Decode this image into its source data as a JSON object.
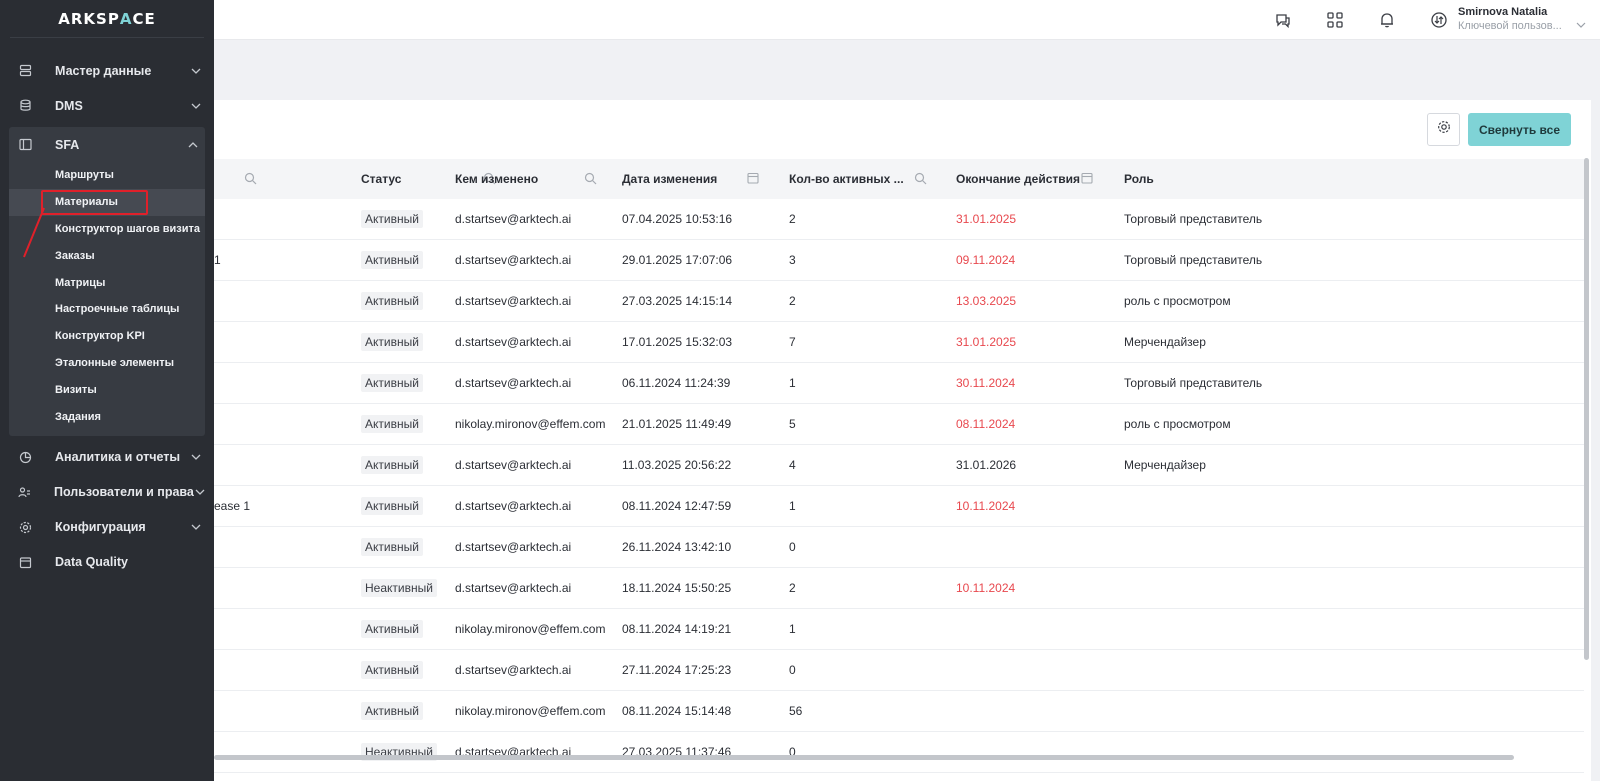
{
  "app": {
    "logo_a": "ARKSP",
    "logo_b": "A",
    "logo_c": "CE"
  },
  "sidebar": {
    "items_top": [
      {
        "label": "Мастер данные",
        "icon": "database-icon"
      },
      {
        "label": "DMS",
        "icon": "stack-icon"
      }
    ],
    "sfa": {
      "label": "SFA",
      "icon": "layout-icon",
      "sub": [
        "Маршруты",
        "Материалы",
        "Конструктор шагов визита",
        "Заказы",
        "Матрицы",
        "Настроечные таблицы",
        "Конструктор KPI",
        "Эталонные элементы",
        "Визиты",
        "Задания"
      ]
    },
    "items_bottom": [
      {
        "label": "Аналитика и отчеты",
        "icon": "chart-icon"
      },
      {
        "label": "Пользователи и права",
        "icon": "users-icon"
      },
      {
        "label": "Конфигурация",
        "icon": "gear-icon"
      },
      {
        "label": "Data Quality",
        "icon": "calendar-icon"
      }
    ]
  },
  "user": {
    "name": "Smirnova Natalia",
    "role": "Ключевой пользов..."
  },
  "toolbar": {
    "collapse_label": "Свернуть все"
  },
  "table": {
    "headers": [
      "Статус",
      "Кем изменено",
      "Дата изменения",
      "Кол-во активных ...",
      "Окончание действия",
      "Роль"
    ],
    "rows": [
      {
        "lead": "",
        "status": "Активный",
        "by": "d.startsev@arktech.ai",
        "date": "07.04.2025 10:53:16",
        "count": "2",
        "end": "31.01.2025",
        "end_expired": true,
        "role": "Торговый представитель"
      },
      {
        "lead": "1",
        "status": "Активный",
        "by": "d.startsev@arktech.ai",
        "date": "29.01.2025 17:07:06",
        "count": "3",
        "end": "09.11.2024",
        "end_expired": true,
        "role": "Торговый представитель"
      },
      {
        "lead": "",
        "status": "Активный",
        "by": "d.startsev@arktech.ai",
        "date": "27.03.2025 14:15:14",
        "count": "2",
        "end": "13.03.2025",
        "end_expired": true,
        "role": "роль с просмотром"
      },
      {
        "lead": "",
        "status": "Активный",
        "by": "d.startsev@arktech.ai",
        "date": "17.01.2025 15:32:03",
        "count": "7",
        "end": "31.01.2025",
        "end_expired": true,
        "role": "Мерчендайзер"
      },
      {
        "lead": "",
        "status": "Активный",
        "by": "d.startsev@arktech.ai",
        "date": "06.11.2024 11:24:39",
        "count": "1",
        "end": "30.11.2024",
        "end_expired": true,
        "role": "Торговый представитель"
      },
      {
        "lead": "",
        "status": "Активный",
        "by": "nikolay.mironov@effem.com",
        "date": "21.01.2025 11:49:49",
        "count": "5",
        "end": "08.11.2024",
        "end_expired": true,
        "role": "роль с просмотром"
      },
      {
        "lead": "",
        "status": "Активный",
        "by": "d.startsev@arktech.ai",
        "date": "11.03.2025 20:56:22",
        "count": "4",
        "end": "31.01.2026",
        "end_expired": false,
        "role": "Мерчендайзер"
      },
      {
        "lead": "ease 1",
        "status": "Активный",
        "by": "d.startsev@arktech.ai",
        "date": "08.11.2024 12:47:59",
        "count": "1",
        "end": "10.11.2024",
        "end_expired": true,
        "role": ""
      },
      {
        "lead": "",
        "status": "Активный",
        "by": "d.startsev@arktech.ai",
        "date": "26.11.2024 13:42:10",
        "count": "0",
        "end": "",
        "end_expired": false,
        "role": ""
      },
      {
        "lead": "",
        "status": "Неактивный",
        "by": "d.startsev@arktech.ai",
        "date": "18.11.2024 15:50:25",
        "count": "2",
        "end": "10.11.2024",
        "end_expired": true,
        "role": ""
      },
      {
        "lead": "",
        "status": "Активный",
        "by": "nikolay.mironov@effem.com",
        "date": "08.11.2024 14:19:21",
        "count": "1",
        "end": "",
        "end_expired": false,
        "role": ""
      },
      {
        "lead": "",
        "status": "Активный",
        "by": "d.startsev@arktech.ai",
        "date": "27.11.2024 17:25:23",
        "count": "0",
        "end": "",
        "end_expired": false,
        "role": ""
      },
      {
        "lead": "",
        "status": "Активный",
        "by": "nikolay.mironov@effem.com",
        "date": "08.11.2024 15:14:48",
        "count": "56",
        "end": "",
        "end_expired": false,
        "role": ""
      },
      {
        "lead": "",
        "status": "Неактивный",
        "by": "d.startsev@arktech.ai",
        "date": "27.03.2025 11:37:46",
        "count": "0",
        "end": "",
        "end_expired": false,
        "role": ""
      }
    ]
  },
  "colors": {
    "sidebar_bg": "#2a2d33",
    "accent": "#7fd3d6",
    "expired": "#e8484e",
    "highlight": "#e0202a"
  }
}
